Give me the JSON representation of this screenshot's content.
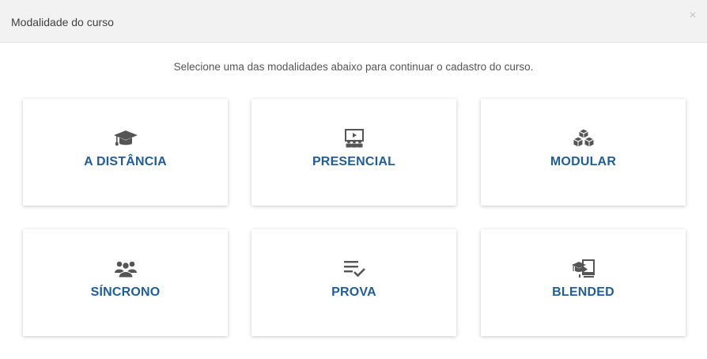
{
  "modal": {
    "title": "Modalidade do curso",
    "close_label": "×"
  },
  "instruction": "Selecione uma das modalidades abaixo para continuar o cadastro do curso.",
  "cards": [
    {
      "label": "A DISTÂNCIA",
      "icon": "graduation-cap-icon"
    },
    {
      "label": "PRESENCIAL",
      "icon": "chalkboard-teacher-icon"
    },
    {
      "label": "MODULAR",
      "icon": "cubes-icon"
    },
    {
      "label": "SÍNCRONO",
      "icon": "users-group-icon"
    },
    {
      "label": "PROVA",
      "icon": "list-check-icon"
    },
    {
      "label": "BLENDED",
      "icon": "blended-learning-icon"
    }
  ],
  "colors": {
    "header_bg": "#f2f2f2",
    "label": "#1f5e98",
    "icon": "#555555",
    "text": "#555555"
  }
}
